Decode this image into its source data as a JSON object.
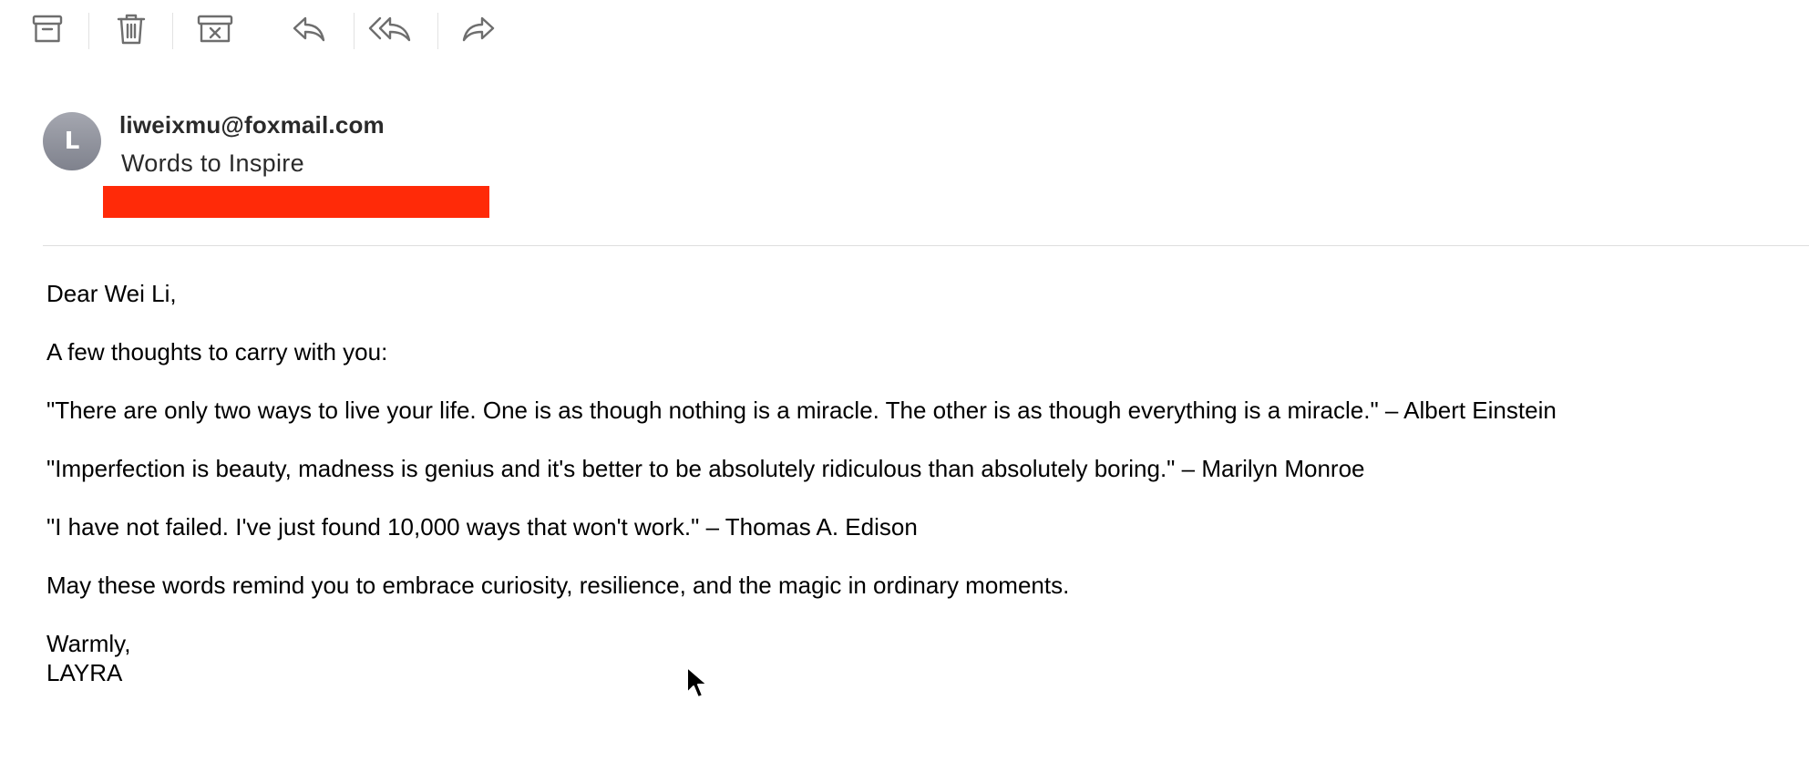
{
  "toolbar": {
    "buttons": [
      {
        "icon": "archive-icon"
      },
      {
        "icon": "trash-icon"
      },
      {
        "icon": "junk-icon"
      },
      {
        "icon": "reply-icon"
      },
      {
        "icon": "reply-all-icon"
      },
      {
        "icon": "forward-icon"
      }
    ],
    "icon_color": "#6e6e6e"
  },
  "message": {
    "avatar_initial": "L",
    "sender": "liweixmu@foxmail.com",
    "subject": "Words to Inspire",
    "redaction_color": "#ff2a08"
  },
  "body": {
    "greeting": "Dear Wei Li,",
    "intro": "A few thoughts to carry with you:",
    "quotes": [
      "\"There are only two ways to live your life. One is as though nothing is a miracle. The other is as though everything is a miracle.\" – Albert Einstein",
      "\"Imperfection is beauty, madness is genius and it's better to be absolutely ridiculous than absolutely boring.\" – Marilyn Monroe",
      "\"I have not failed. I've just found 10,000 ways that won't work.\" – Thomas A. Edison"
    ],
    "closing": "May these words remind you to embrace curiosity, resilience, and the magic in ordinary moments.",
    "signoff": "Warmly,",
    "signature": "LAYRA"
  }
}
